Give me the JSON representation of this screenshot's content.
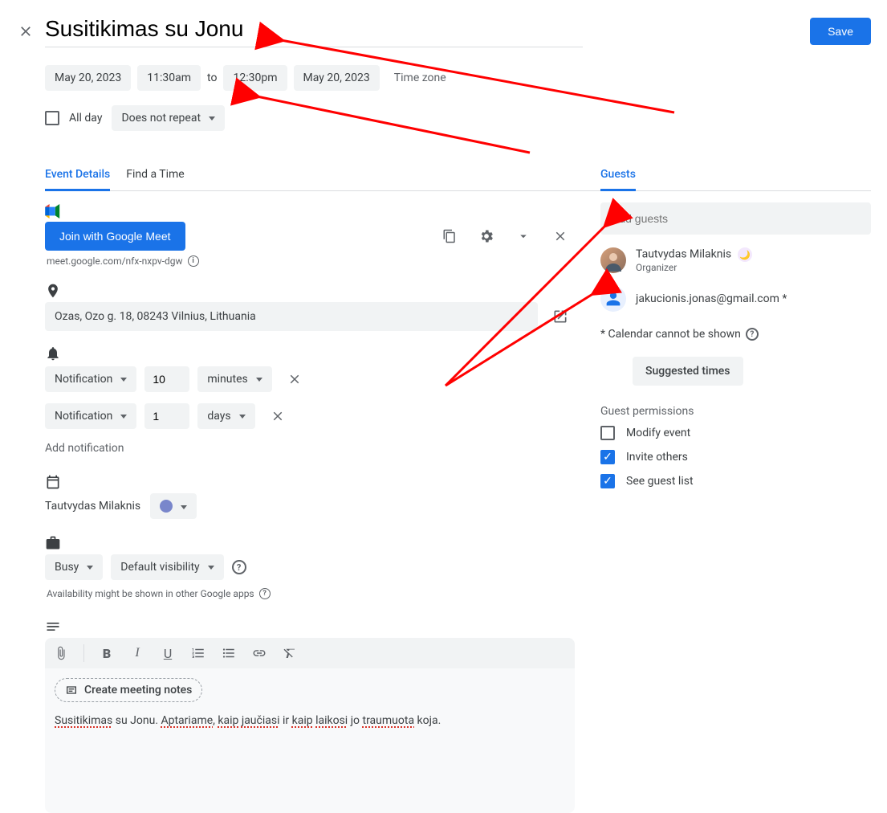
{
  "header": {
    "title": "Susitikimas su Jonu",
    "save_label": "Save"
  },
  "date": {
    "start_date": "May 20, 2023",
    "start_time": "11:30am",
    "to_word": "to",
    "end_time": "12:30pm",
    "end_date": "May 20, 2023",
    "timezone_label": "Time zone"
  },
  "allday": {
    "label": "All day",
    "recurrence": "Does not repeat"
  },
  "tabs": {
    "details": "Event Details",
    "findtime": "Find a Time"
  },
  "meet": {
    "join_label": "Join with Google Meet",
    "link_text": "meet.google.com/nfx-nxpv-dgw"
  },
  "location": "Ozas, Ozo g. 18, 08243 Vilnius, Lithuania",
  "notifications": {
    "type_label": "Notification",
    "n1_value": "10",
    "n1_unit": "minutes",
    "n2_value": "1",
    "n2_unit": "days",
    "add_label": "Add notification"
  },
  "calendar": {
    "owner_name": "Tautvydas Milaknis"
  },
  "visibility": {
    "busy_label": "Busy",
    "visibility_label": "Default visibility",
    "avail_note": "Availability might be shown in other Google apps"
  },
  "editor": {
    "create_notes_label": "Create meeting notes",
    "description_text": "Susitikimas su Jonu. Aptariame, kaip jaučiasi ir kaip laikosi jo traumuota koja."
  },
  "guests": {
    "heading": "Guests",
    "placeholder": "Add guests",
    "organizer_name": "Tautvydas Milaknis",
    "organizer_sub": "Organizer",
    "guest2_email": "jakucionis.jonas@gmail.com",
    "asterisk_note": "* Calendar cannot be shown",
    "suggested_label": "Suggested times",
    "permissions_heading": "Guest permissions",
    "perm_modify": "Modify event",
    "perm_invite": "Invite others",
    "perm_seelist": "See guest list"
  }
}
